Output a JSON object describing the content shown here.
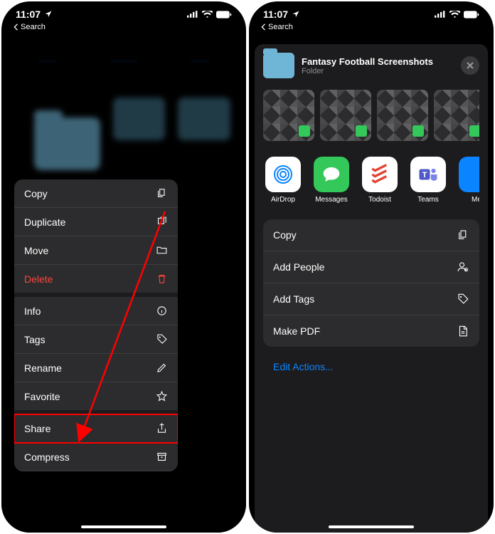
{
  "status": {
    "time": "11:07",
    "back_label": "Search"
  },
  "left_phone": {
    "context_menu": [
      {
        "label": "Copy",
        "icon": "copy-icon",
        "destructive": false
      },
      {
        "label": "Duplicate",
        "icon": "duplicate-icon",
        "destructive": false
      },
      {
        "label": "Move",
        "icon": "folder-icon",
        "destructive": false
      },
      {
        "label": "Delete",
        "icon": "trash-icon",
        "destructive": true
      },
      {
        "label": "Info",
        "icon": "info-icon",
        "destructive": false
      },
      {
        "label": "Tags",
        "icon": "tag-icon",
        "destructive": false
      },
      {
        "label": "Rename",
        "icon": "pencil-icon",
        "destructive": false
      },
      {
        "label": "Favorite",
        "icon": "star-icon",
        "destructive": false
      },
      {
        "label": "Share",
        "icon": "share-icon",
        "destructive": false
      },
      {
        "label": "Compress",
        "icon": "archive-icon",
        "destructive": false
      }
    ],
    "highlighted_item": "Share"
  },
  "right_phone": {
    "sheet_title": "Fantasy Football Screenshots",
    "sheet_subtitle": "Folder",
    "apps": [
      {
        "label": "AirDrop",
        "name": "airdrop"
      },
      {
        "label": "Messages",
        "name": "messages"
      },
      {
        "label": "Todoist",
        "name": "todoist"
      },
      {
        "label": "Teams",
        "name": "teams"
      },
      {
        "label": "Me",
        "name": "more"
      }
    ],
    "actions": [
      {
        "label": "Copy",
        "icon": "copy-icon"
      },
      {
        "label": "Add People",
        "icon": "people-icon"
      },
      {
        "label": "Add Tags",
        "icon": "tag-icon"
      },
      {
        "label": "Make PDF",
        "icon": "document-icon"
      }
    ],
    "edit_actions_label": "Edit Actions..."
  }
}
